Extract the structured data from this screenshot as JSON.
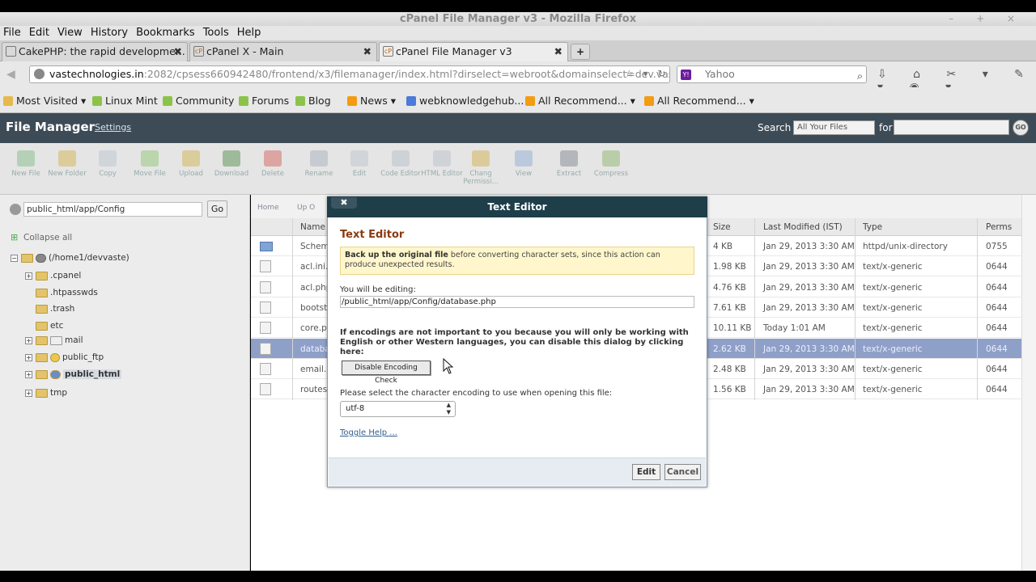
{
  "window": {
    "title": "cPanel File Manager v3 - Mozilla Firefox",
    "controls": "– + ×"
  },
  "menu": [
    "File",
    "Edit",
    "View",
    "History",
    "Bookmarks",
    "Tools",
    "Help"
  ],
  "tabs": [
    {
      "label": "CakePHP: the rapid developme...",
      "close": "✖"
    },
    {
      "label": "cPanel X - Main",
      "close": "✖"
    },
    {
      "label": "cPanel File Manager v3",
      "close": "✖"
    }
  ],
  "new_tab": "+",
  "address": {
    "host": "vastechnologies.in",
    "rest": ":2082/cpsess660942480/frontend/x3/filemanager/index.html?dirselect=webroot&domainselect=dev.vast",
    "controls": "☆ ▾ ↻"
  },
  "search_engine": {
    "placeholder": "Yahoo",
    "logo": "Y!",
    "icon": "search-icon"
  },
  "nav_icons": "⇩ ⌂ ✂ ▾ ✎ ▾ ◉ ▾",
  "bookmarks": [
    "Most Visited ▾",
    "Linux Mint",
    "Community",
    "Forums",
    "Blog",
    "News ▾",
    "webknowledgehub...",
    "All Recommend... ▾",
    "All Recommend... ▾"
  ],
  "fm": {
    "title": "File Manager",
    "settings": "Settings",
    "search_label": "Search",
    "search_scope": "All Your Files",
    "for_label": "for",
    "go": "GO"
  },
  "toolbar": [
    {
      "label": "New File",
      "color": "#9fc9a4"
    },
    {
      "label": "New Folder",
      "color": "#d9c27a"
    },
    {
      "label": "Copy",
      "color": "#c7cfd6"
    },
    {
      "label": "Move File",
      "color": "#a9cf95"
    },
    {
      "label": "Upload",
      "color": "#d6c27c"
    },
    {
      "label": "Download",
      "color": "#7fa97a"
    },
    {
      "label": "Delete",
      "color": "#d98a84"
    },
    {
      "label": "Rename",
      "color": "#b9c1c9"
    },
    {
      "label": "Edit",
      "color": "#c9cfd5"
    },
    {
      "label": "Code Editor",
      "color": "#c3cad2"
    },
    {
      "label": "HTML Editor",
      "color": "#c6ccd1"
    },
    {
      "label": "Chang Permissi...",
      "color": "#d8c07a"
    },
    {
      "label": "View",
      "color": "#a8bfd8"
    },
    {
      "label": "Extract",
      "color": "#9ea4aa"
    },
    {
      "label": "Compress",
      "color": "#a7c48f"
    }
  ],
  "tree": {
    "path": "public_html/app/Config",
    "go": "Go",
    "collapse_all": "Collapse all",
    "root": "(/home1/devvaste)",
    "items": [
      ".cpanel",
      ".htpasswds",
      ".trash",
      "etc",
      "mail",
      "public_ftp",
      "public_html",
      "tmp"
    ]
  },
  "breadcrumb": {
    "home": "Home",
    "up": "Up O"
  },
  "columns": {
    "name": "Name",
    "size": "Size",
    "modified": "Last Modified (IST)",
    "type": "Type",
    "perms": "Perms"
  },
  "files": [
    {
      "name": "Schem",
      "size": "4 KB",
      "modified": "Jan 29, 2013 3:30 AM",
      "type": "httpd/unix-directory",
      "perms": "0755"
    },
    {
      "name": "acl.ini.p",
      "size": "1.98 KB",
      "modified": "Jan 29, 2013 3:30 AM",
      "type": "text/x-generic",
      "perms": "0644"
    },
    {
      "name": "acl.php",
      "size": "4.76 KB",
      "modified": "Jan 29, 2013 3:30 AM",
      "type": "text/x-generic",
      "perms": "0644"
    },
    {
      "name": "bootstr",
      "size": "7.61 KB",
      "modified": "Jan 29, 2013 3:30 AM",
      "type": "text/x-generic",
      "perms": "0644"
    },
    {
      "name": "core.ph",
      "size": "10.11 KB",
      "modified": "Today 1:01 AM",
      "type": "text/x-generic",
      "perms": "0644"
    },
    {
      "name": "databas",
      "size": "2.62 KB",
      "modified": "Jan 29, 2013 3:30 AM",
      "type": "text/x-generic",
      "perms": "0644"
    },
    {
      "name": "email.p",
      "size": "2.48 KB",
      "modified": "Jan 29, 2013 3:30 AM",
      "type": "text/x-generic",
      "perms": "0644"
    },
    {
      "name": "routes.",
      "size": "1.56 KB",
      "modified": "Jan 29, 2013 3:30 AM",
      "type": "text/x-generic",
      "perms": "0644"
    }
  ],
  "dialog": {
    "header": "Text Editor",
    "close": "✖",
    "title": "Text Editor",
    "warning_bold": "Back up the original file",
    "warning_rest": " before converting character sets, since this action can produce unexpected results.",
    "editing_label": "You will be editing:",
    "editing_path": "/public_html/app/Config/database.php",
    "encoding_info": "If encodings are not important to you because you will only be working with English or other Western languages, you can disable this dialog by clicking here:",
    "disable_button": "Disable Encoding Check",
    "select_label": "Please select the character encoding to use when opening this file:",
    "encoding": "utf-8",
    "toggle_help": "Toggle Help ...",
    "edit_button": "Edit",
    "cancel_button": "Cancel"
  }
}
